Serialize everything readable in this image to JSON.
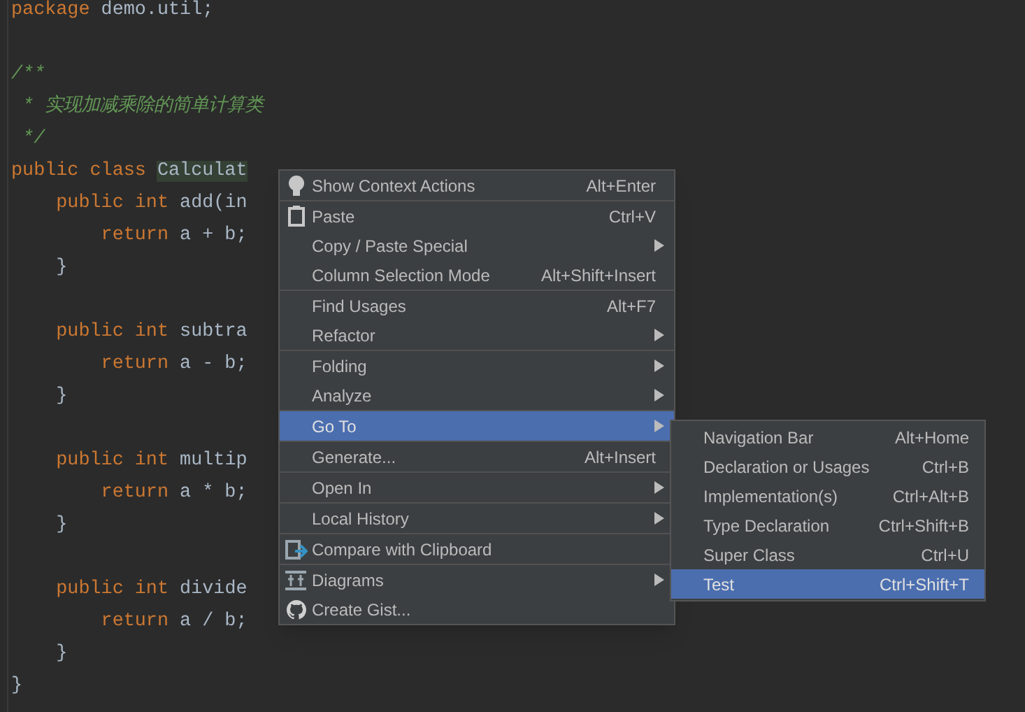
{
  "editor": {
    "lines": [
      [
        {
          "kind": "keyword",
          "text": "package"
        },
        {
          "kind": "plain",
          "text": " demo.util;"
        }
      ],
      {
        "kind": "blank"
      },
      [
        {
          "kind": "comment",
          "text": "/**"
        }
      ],
      [
        {
          "kind": "comment",
          "text": " * 实现加减乘除的简单计算类"
        }
      ],
      [
        {
          "kind": "comment",
          "text": " */"
        }
      ],
      [
        {
          "kind": "keyword",
          "text": "public class "
        },
        {
          "kind": "highlight",
          "text": "Calculat"
        }
      ],
      [
        {
          "kind": "keyword",
          "text": "    public int "
        },
        {
          "kind": "method",
          "text": "add(in"
        }
      ],
      [
        {
          "kind": "keyword",
          "text": "        return"
        },
        {
          "kind": "plain",
          "text": " a + b;"
        }
      ],
      [
        {
          "kind": "plain",
          "text": "    }"
        }
      ],
      {
        "kind": "blank"
      },
      [
        {
          "kind": "keyword",
          "text": "    public int "
        },
        {
          "kind": "method",
          "text": "subtra"
        }
      ],
      [
        {
          "kind": "keyword",
          "text": "        return"
        },
        {
          "kind": "plain",
          "text": " a - b;"
        }
      ],
      [
        {
          "kind": "plain",
          "text": "    }"
        }
      ],
      {
        "kind": "blank"
      },
      [
        {
          "kind": "keyword",
          "text": "    public int "
        },
        {
          "kind": "method",
          "text": "multip"
        }
      ],
      [
        {
          "kind": "keyword",
          "text": "        return"
        },
        {
          "kind": "plain",
          "text": " a * b;"
        }
      ],
      [
        {
          "kind": "plain",
          "text": "    }"
        }
      ],
      {
        "kind": "blank"
      },
      [
        {
          "kind": "keyword",
          "text": "    public int "
        },
        {
          "kind": "method",
          "text": "divide"
        }
      ],
      [
        {
          "kind": "keyword",
          "text": "        return"
        },
        {
          "kind": "plain",
          "text": " a / b;"
        }
      ],
      [
        {
          "kind": "plain",
          "text": "    }"
        }
      ],
      [
        {
          "kind": "plain",
          "text": "}"
        }
      ]
    ]
  },
  "context_menu": {
    "groups": [
      [
        {
          "label": "Show Context Actions",
          "shortcut": "Alt+Enter",
          "submenu": false,
          "selected": false
        }
      ],
      [
        {
          "label": "Paste",
          "shortcut": "Ctrl+V",
          "submenu": false,
          "selected": false
        },
        {
          "label": "Copy / Paste Special",
          "submenu": true,
          "selected": false
        },
        {
          "label": "Column Selection Mode",
          "shortcut": "Alt+Shift+Insert",
          "submenu": false,
          "selected": false
        }
      ],
      [
        {
          "label": "Find Usages",
          "shortcut": "Alt+F7",
          "submenu": false,
          "selected": false
        },
        {
          "label": "Refactor",
          "submenu": true,
          "selected": false
        }
      ],
      [
        {
          "label": "Folding",
          "submenu": true,
          "selected": false
        },
        {
          "label": "Analyze",
          "submenu": true,
          "selected": false
        }
      ],
      [
        {
          "label": "Go To",
          "submenu": true,
          "selected": true
        }
      ],
      [
        {
          "label": "Generate...",
          "shortcut": "Alt+Insert",
          "submenu": false,
          "selected": false
        }
      ],
      [
        {
          "label": "Open In",
          "submenu": true,
          "selected": false
        }
      ],
      [
        {
          "label": "Local History",
          "submenu": true,
          "selected": false
        }
      ],
      [
        {
          "label": "Compare with Clipboard",
          "submenu": false,
          "selected": false
        }
      ],
      [
        {
          "label": "Diagrams",
          "submenu": true,
          "selected": false
        },
        {
          "label": "Create Gist...",
          "submenu": false,
          "selected": false
        }
      ]
    ]
  },
  "submenu": {
    "items": [
      {
        "label": "Navigation Bar",
        "shortcut": "Alt+Home",
        "selected": false
      },
      {
        "label": "Declaration or Usages",
        "shortcut": "Ctrl+B",
        "selected": false
      },
      {
        "label": "Implementation(s)",
        "shortcut": "Ctrl+Alt+B",
        "selected": false
      },
      {
        "label": "Type Declaration",
        "shortcut": "Ctrl+Shift+B",
        "selected": false
      },
      {
        "label": "Super Class",
        "shortcut": "Ctrl+U",
        "selected": false
      },
      {
        "label": "Test",
        "shortcut": "Ctrl+Shift+T",
        "selected": true
      }
    ]
  }
}
